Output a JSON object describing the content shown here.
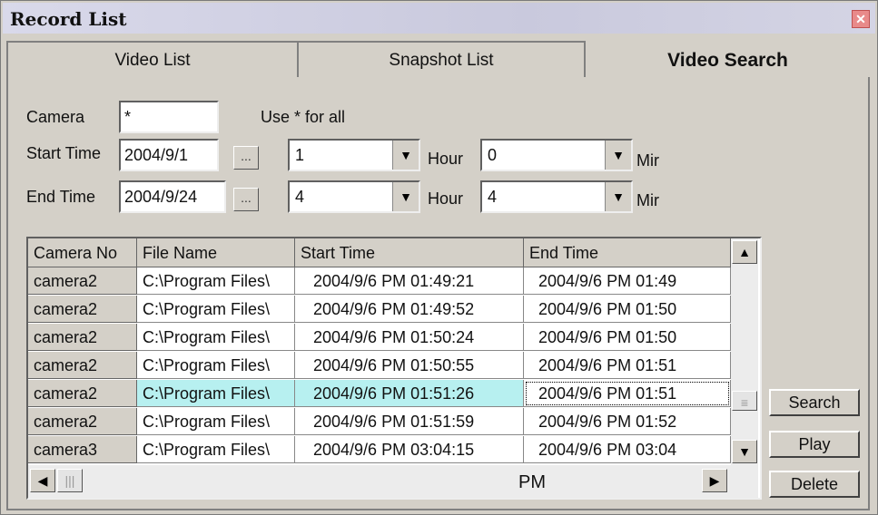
{
  "window": {
    "title": "Record List",
    "close": "✕"
  },
  "tabs": [
    {
      "label": "Video List"
    },
    {
      "label": "Snapshot List"
    },
    {
      "label": "Video Search"
    }
  ],
  "form": {
    "camera_label": "Camera",
    "camera_value": "*",
    "camera_hint": "Use * for all",
    "start_label": "Start Time",
    "start_date": "2004/9/1",
    "start_hour": "1",
    "start_min": "0",
    "end_label": "End Time",
    "end_date": "2004/9/24",
    "end_hour": "4",
    "end_min": "4",
    "hour_label": "Hour",
    "min_label": "Mir",
    "dots_label": "..."
  },
  "grid": {
    "columns": [
      "Camera No",
      "File Name",
      "Start Time",
      "End Time"
    ],
    "rows": [
      {
        "camera": "camera2",
        "file": "C:\\Program Files\\",
        "start": "2004/9/6  PM  01:49:21",
        "end": "2004/9/6  PM  01:49"
      },
      {
        "camera": "camera2",
        "file": "C:\\Program Files\\",
        "start": "2004/9/6  PM  01:49:52",
        "end": "2004/9/6  PM  01:50"
      },
      {
        "camera": "camera2",
        "file": "C:\\Program Files\\",
        "start": "2004/9/6  PM  01:50:24",
        "end": "2004/9/6  PM  01:50"
      },
      {
        "camera": "camera2",
        "file": "C:\\Program Files\\",
        "start": "2004/9/6  PM  01:50:55",
        "end": "2004/9/6  PM  01:51"
      },
      {
        "camera": "camera2",
        "file": "C:\\Program Files\\",
        "start": "2004/9/6  PM  01:51:26",
        "end": "2004/9/6  PM  01:51"
      },
      {
        "camera": "camera2",
        "file": "C:\\Program Files\\",
        "start": "2004/9/6  PM  01:51:59",
        "end": "2004/9/6  PM  01:52"
      },
      {
        "camera": "camera3",
        "file": "C:\\Program Files\\",
        "start": "2004/9/6  PM  03:04:15",
        "end": "2004/9/6  PM  03:04"
      }
    ],
    "selected_row": 4,
    "partial_cell": "PM"
  },
  "buttons": {
    "search": "Search",
    "play": "Play",
    "delete": "Delete"
  },
  "colors": {
    "selection": "#b7f0f0",
    "title_bg": "#d0d0e4",
    "face": "#d4d0c8"
  }
}
